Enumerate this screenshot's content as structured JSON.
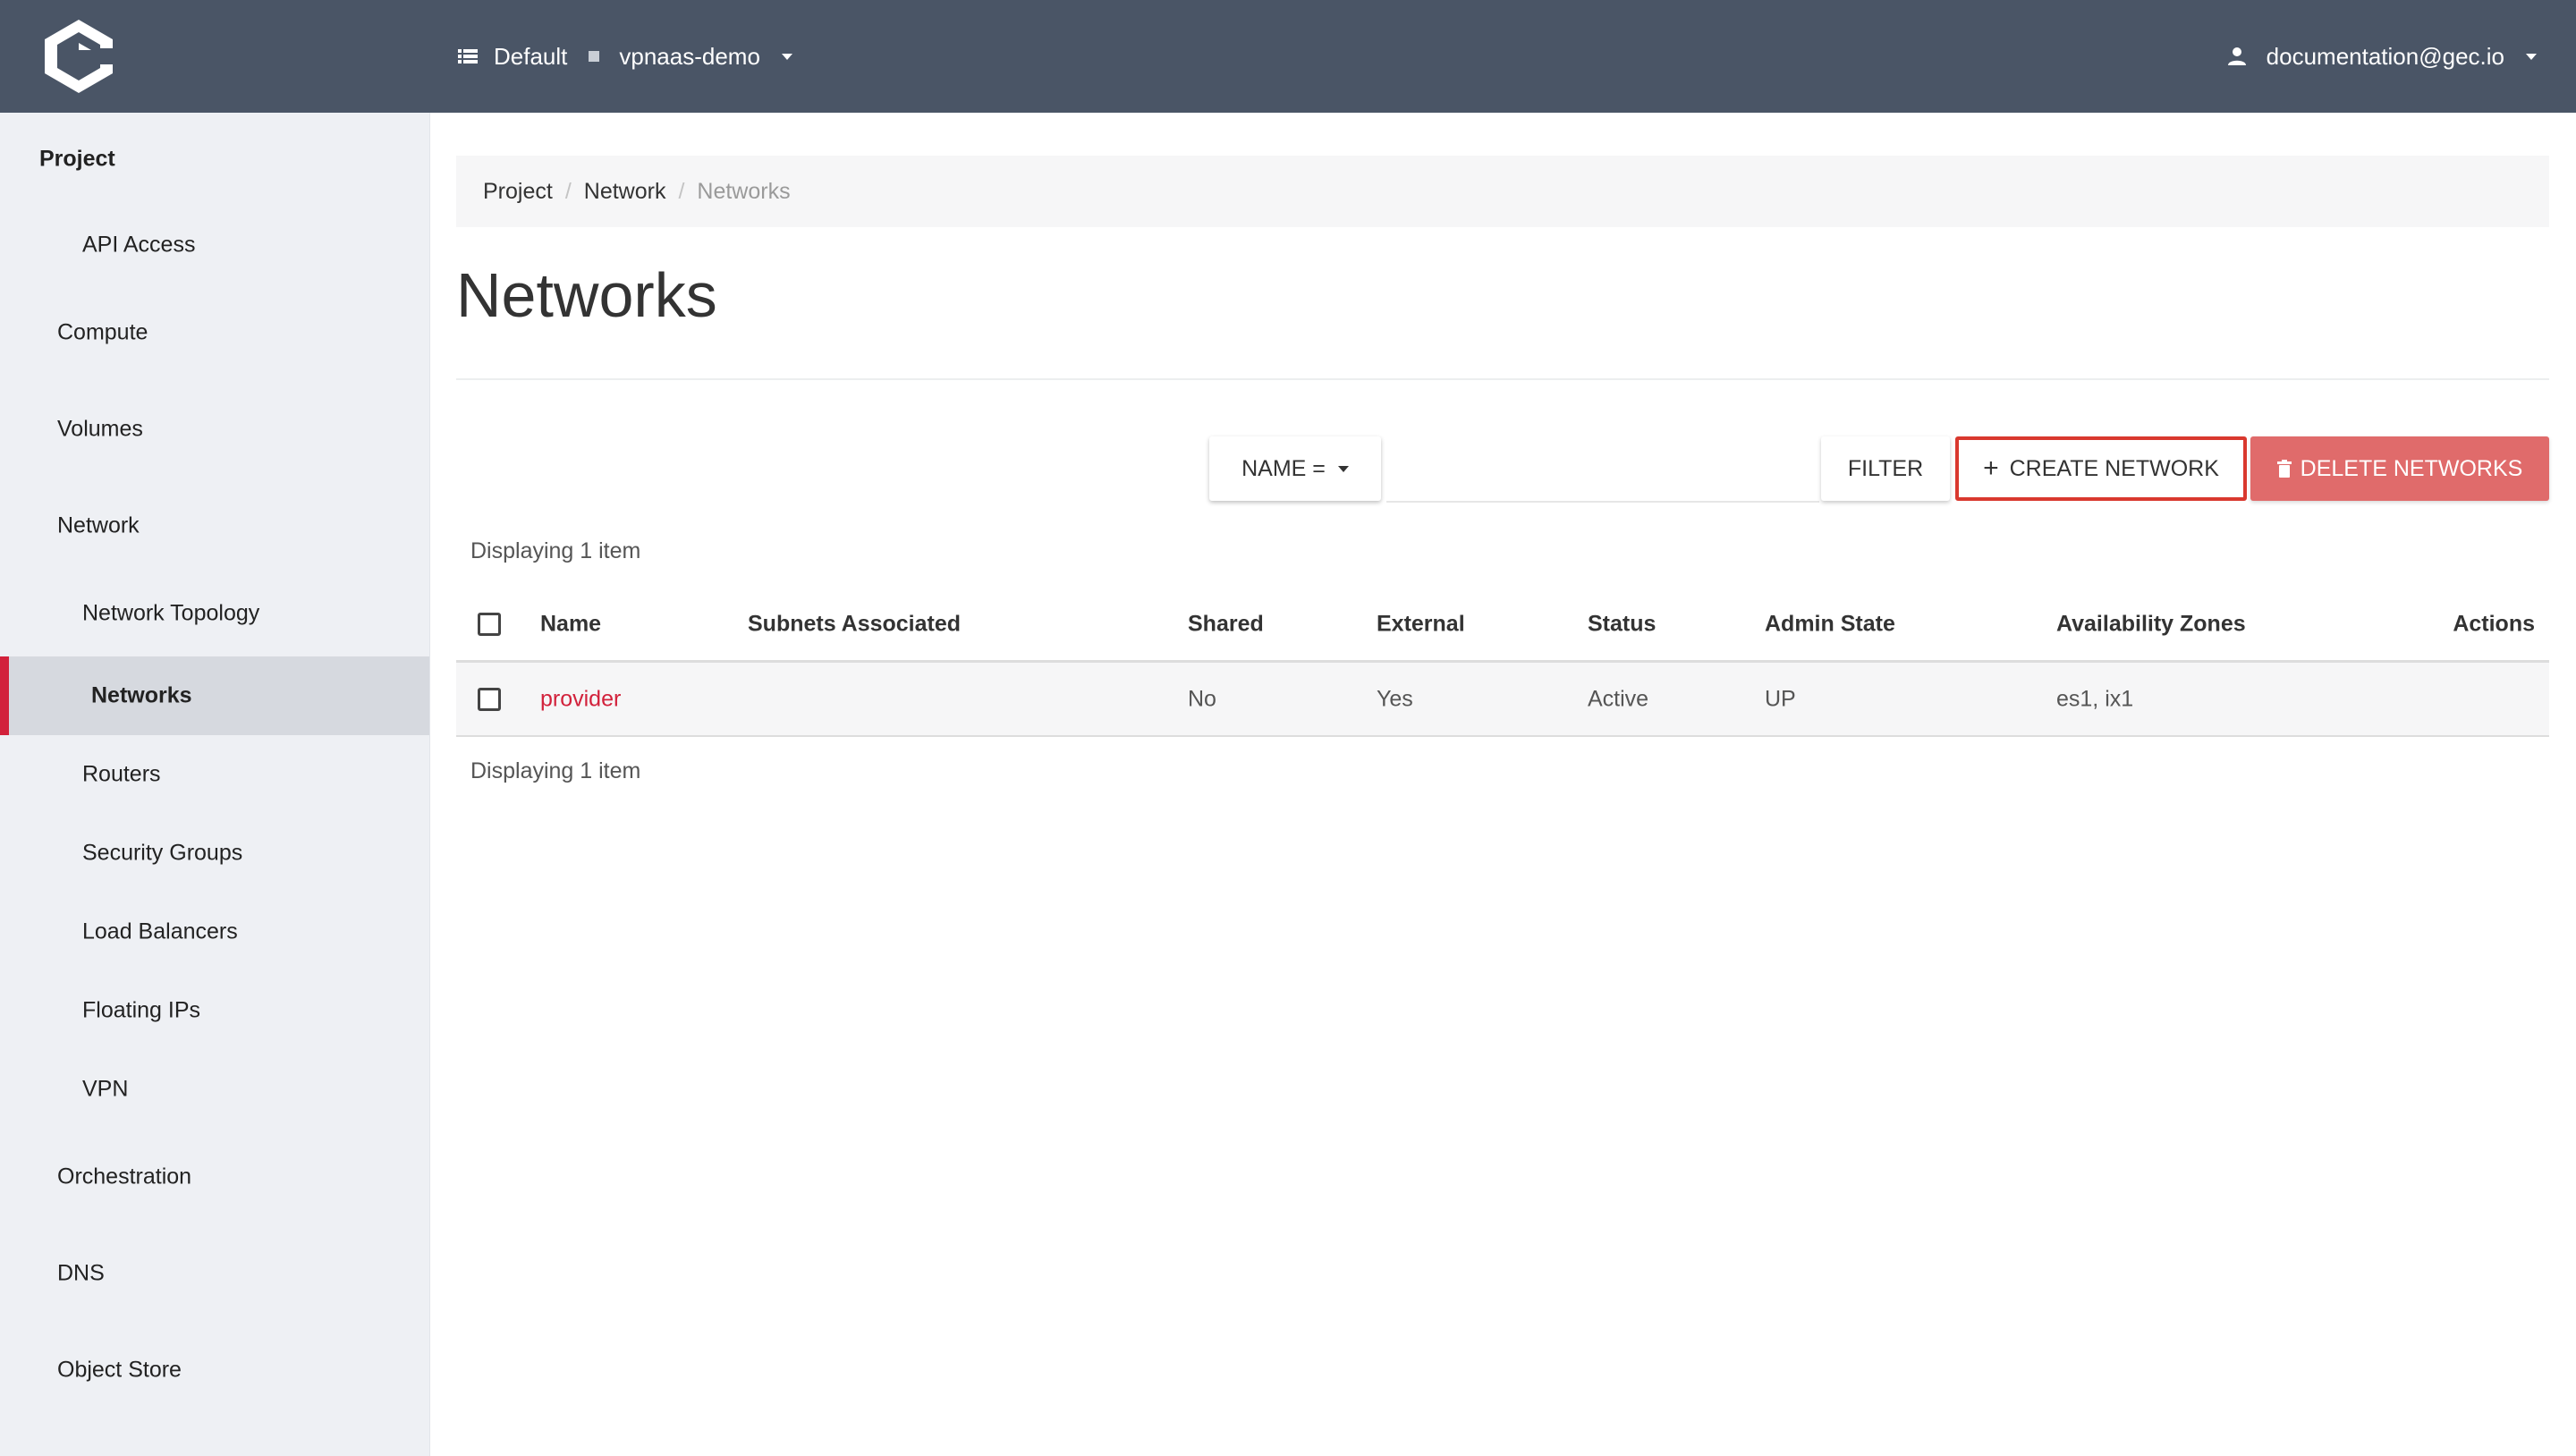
{
  "header": {
    "domain": "Default",
    "project": "vpnaas-demo",
    "user": "documentation@gec.io"
  },
  "sidebar": {
    "section": "Project",
    "items": [
      {
        "label": "API Access"
      },
      {
        "label": "Compute"
      },
      {
        "label": "Volumes"
      },
      {
        "label": "Network"
      },
      {
        "label": "Network Topology"
      },
      {
        "label": "Networks"
      },
      {
        "label": "Routers"
      },
      {
        "label": "Security Groups"
      },
      {
        "label": "Load Balancers"
      },
      {
        "label": "Floating IPs"
      },
      {
        "label": "VPN"
      },
      {
        "label": "Orchestration"
      },
      {
        "label": "DNS"
      },
      {
        "label": "Object Store"
      }
    ]
  },
  "breadcrumb": {
    "items": [
      "Project",
      "Network",
      "Networks"
    ],
    "divider": "/"
  },
  "page": {
    "title": "Networks"
  },
  "toolbar": {
    "filter_field": "NAME =",
    "filter_value": "",
    "filter_button": "FILTER",
    "create_button": "CREATE NETWORK",
    "create_icon": "+",
    "delete_button": "DELETE NETWORKS"
  },
  "table": {
    "count_top": "Displaying 1 item",
    "count_bottom": "Displaying 1 item",
    "columns": [
      "Name",
      "Subnets Associated",
      "Shared",
      "External",
      "Status",
      "Admin State",
      "Availability Zones",
      "Actions"
    ],
    "rows": [
      {
        "name": "provider",
        "subnets": "",
        "shared": "No",
        "external": "Yes",
        "status": "Active",
        "admin_state": "UP",
        "zones": "es1, ix1",
        "actions": ""
      }
    ]
  },
  "colors": {
    "topbar": "#4a5566",
    "accent": "#d2213b",
    "delete": "#e06b6b",
    "highlight_border": "#d9382e"
  }
}
